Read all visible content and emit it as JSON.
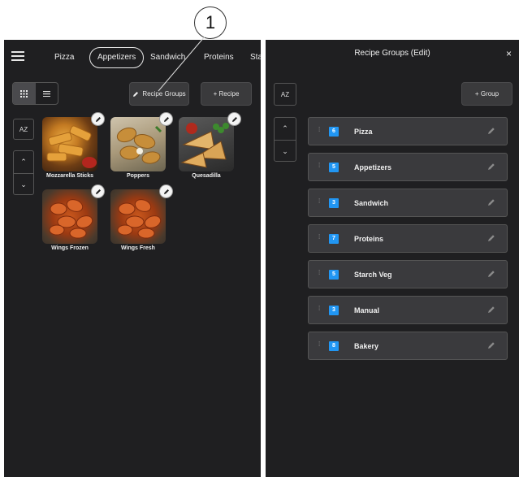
{
  "callout": {
    "number": "1"
  },
  "left_panel": {
    "tabs": [
      {
        "label": "Pizza",
        "active": false
      },
      {
        "label": "Appetizers",
        "active": true
      },
      {
        "label": "Sandwich",
        "active": false
      },
      {
        "label": "Proteins",
        "active": false
      },
      {
        "label": "Sta",
        "active": false
      }
    ],
    "recipe_groups_button": "Recipe Groups",
    "add_recipe_button": "+ Recipe",
    "sort_button": "AZ",
    "recipes": [
      {
        "name": "Mozzarella Sticks",
        "image": "mozzarella-sticks"
      },
      {
        "name": "Poppers",
        "image": "poppers"
      },
      {
        "name": "Quesadilla",
        "image": "quesadilla"
      },
      {
        "name": "Wings Frozen",
        "image": "chicken-wings"
      },
      {
        "name": "Wings Fresh",
        "image": "chicken-wings"
      }
    ]
  },
  "right_panel": {
    "title": "Recipe Groups (Edit)",
    "close_label": "×",
    "sort_button": "AZ",
    "add_group_button": "+ Group",
    "groups": [
      {
        "count": "6",
        "name": "Pizza"
      },
      {
        "count": "5",
        "name": "Appetizers"
      },
      {
        "count": "3",
        "name": "Sandwich"
      },
      {
        "count": "7",
        "name": "Proteins"
      },
      {
        "count": "5",
        "name": "Starch Veg"
      },
      {
        "count": "3",
        "name": "Manual"
      },
      {
        "count": "8",
        "name": "Bakery"
      }
    ]
  },
  "colors": {
    "panel_bg": "#1f1f21",
    "row_bg": "#3a3a3d",
    "badge": "#2196f3"
  }
}
